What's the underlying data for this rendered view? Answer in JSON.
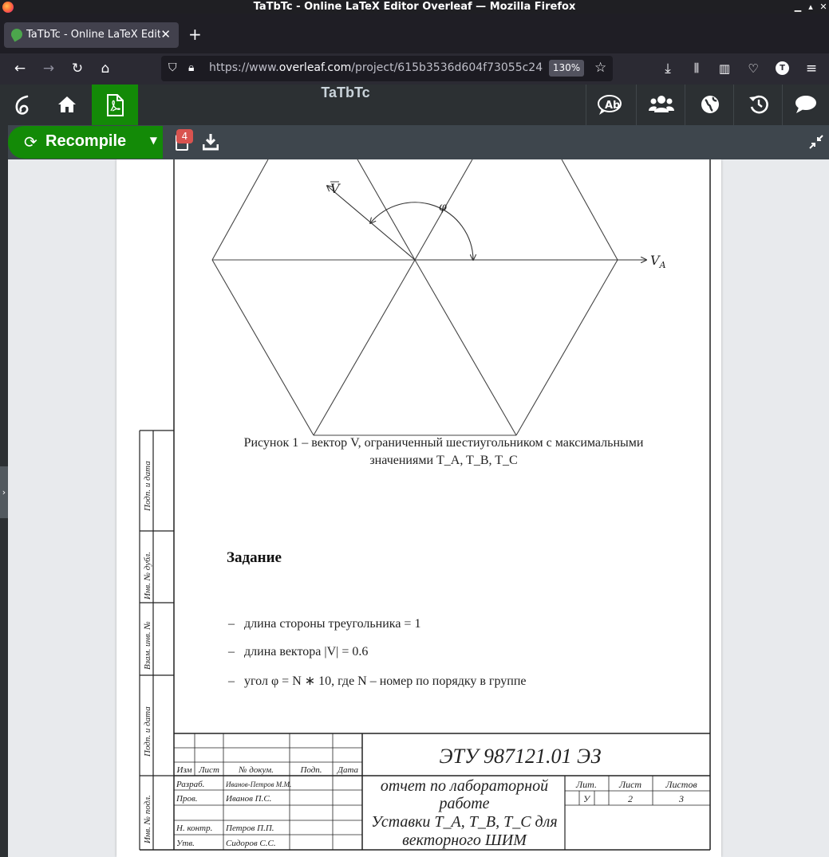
{
  "window": {
    "title": "TaTbTc - Online LaTeX Editor Overleaf — Mozilla Firefox"
  },
  "tab": {
    "label": "TaTbTc - Online LaTeX Editor Overleaf"
  },
  "address": {
    "url_prefix": "https://www.",
    "url_domain": "overleaf.com",
    "url_path": "/project/615b3536d604f73055c24",
    "zoom": "130%"
  },
  "header": {
    "project_title": "TaTbTc"
  },
  "toolbar": {
    "recompile_label": "Recompile",
    "logs_count": "4"
  },
  "document": {
    "diagram": {
      "vector_label": "V",
      "axis_label": "V",
      "axis_sub": "A",
      "angle_label": "φ"
    },
    "caption_line1": "Рисунок 1 – вектор V, ограниченный шестиугольником с максимальными",
    "caption_line2": "значениями T_A, T_B, T_C",
    "heading": "Задание",
    "items": [
      "длина стороны треугольника = 1",
      "длина вектора |V| = 0.6",
      "угол φ = N ∗ 10, где N – номер по порядку в группе"
    ],
    "side_labels": [
      "Подп. и дата",
      "Инв. № дубл.",
      "Взам. инв. №",
      "Подп. и дата",
      "Инв. № подл."
    ],
    "stamp": {
      "code": "ЭТУ 987121.01 ЭЗ",
      "col_headers": [
        "Изм",
        "Лист",
        "№ докум.",
        "Подп.",
        "Дата"
      ],
      "roles": [
        {
          "role": "Разраб.",
          "name": "Иванов-Петров М.М."
        },
        {
          "role": "Пров.",
          "name": "Иванов П.С."
        },
        {
          "role": "",
          "name": ""
        },
        {
          "role": "Н. контр.",
          "name": "Петров П.П."
        },
        {
          "role": "Утв.",
          "name": "Сидоров С.С."
        }
      ],
      "doc_title_line1": "отчет по лабораторной",
      "doc_title_line2": "работе",
      "doc_title_line3": "Уставки T_A, T_B, T_C для",
      "doc_title_line4": "векторного ШИМ",
      "lit_header": "Лит.",
      "sheet_header": "Лист",
      "sheets_header": "Листов",
      "lit_value": "У",
      "sheet_value": "2",
      "sheets_value": "3"
    }
  }
}
